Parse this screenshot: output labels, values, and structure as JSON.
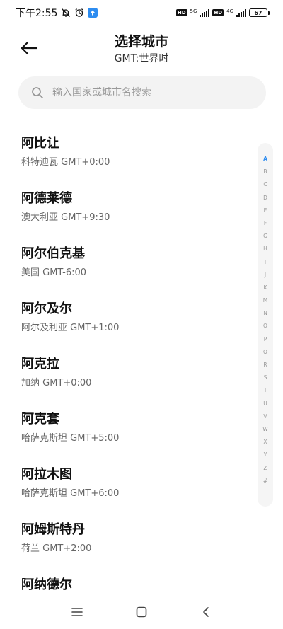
{
  "status_bar": {
    "time": "下午2:55",
    "net1": "5G",
    "net2": "4G",
    "hd1": "HD",
    "hd2": "HD",
    "battery": "67"
  },
  "header": {
    "title": "选择城市",
    "subtitle": "GMT:世界时"
  },
  "search": {
    "placeholder": "输入国家或城市名搜索",
    "value": ""
  },
  "cities": [
    {
      "name": "阿比让",
      "detail": "科特迪瓦 GMT+0:00"
    },
    {
      "name": "阿德莱德",
      "detail": "澳大利亚 GMT+9:30"
    },
    {
      "name": "阿尔伯克基",
      "detail": "美国 GMT-6:00"
    },
    {
      "name": "阿尔及尔",
      "detail": "阿尔及利亚 GMT+1:00"
    },
    {
      "name": "阿克拉",
      "detail": "加纳 GMT+0:00"
    },
    {
      "name": "阿克套",
      "detail": "哈萨克斯坦 GMT+5:00"
    },
    {
      "name": "阿拉木图",
      "detail": "哈萨克斯坦 GMT+6:00"
    },
    {
      "name": "阿姆斯特丹",
      "detail": "荷兰 GMT+2:00"
    },
    {
      "name": "阿纳德尔",
      "detail": ""
    }
  ],
  "alphabet": [
    "A",
    "B",
    "C",
    "D",
    "E",
    "F",
    "G",
    "H",
    "I",
    "J",
    "K",
    "M",
    "N",
    "O",
    "P",
    "Q",
    "R",
    "S",
    "T",
    "U",
    "V",
    "W",
    "X",
    "Y",
    "Z",
    "#"
  ],
  "alphabet_active": "A",
  "colors": {
    "accent": "#2d8cf0",
    "search_bg": "#f3f3f3",
    "index_bg": "#f5f5f5"
  },
  "icons": {
    "back": "arrow-left-icon",
    "search": "search-icon",
    "menu": "menu-icon",
    "home": "home-icon",
    "nav_back": "chevron-left-icon"
  }
}
